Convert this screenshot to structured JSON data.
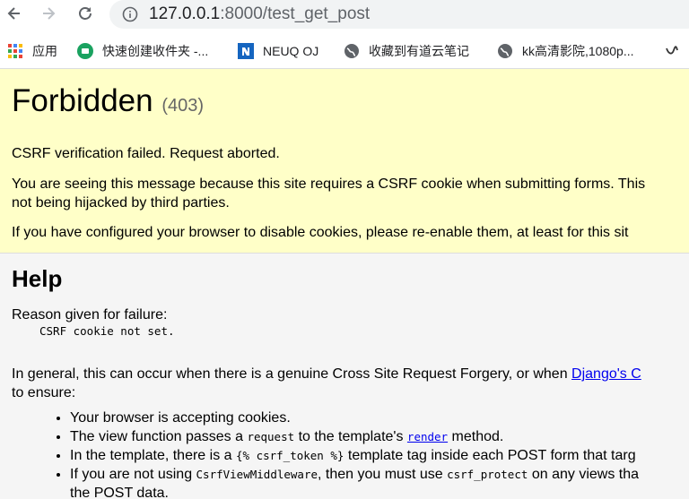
{
  "browser": {
    "url_host": "127.0.0.1",
    "url_rest": ":8000/test_get_post",
    "bookmarks": [
      {
        "label": "应用",
        "icon": "apps-grid-icon"
      },
      {
        "label": "快速创建收件夹 -...",
        "icon": "green-app-icon"
      },
      {
        "label": "NEUQ OJ",
        "icon": "blue-n-icon"
      },
      {
        "label": "收藏到有道云笔记",
        "icon": "globe-icon"
      },
      {
        "label": "kk高清影院,1080p...",
        "icon": "globe-icon"
      }
    ]
  },
  "summary": {
    "title": "Forbidden",
    "code": "(403)",
    "line1": "CSRF verification failed. Request aborted.",
    "line2a": "You are seeing this message because this site requires a CSRF cookie when submitting forms. This",
    "line2b": "not being hijacked by third parties.",
    "line3": "If you have configured your browser to disable cookies, please re-enable them, at least for this sit"
  },
  "help": {
    "heading": "Help",
    "reason_label": "Reason given for failure:",
    "reason": "CSRF cookie not set.",
    "general_a": "In general, this can occur when there is a genuine Cross Site Request Forgery, or when ",
    "general_link": "Django's C",
    "general_b": "to ensure:",
    "items": {
      "i1": "Your browser is accepting cookies.",
      "i2_a": "The view function passes a ",
      "i2_code": "request",
      "i2_b": " to the template's ",
      "i2_link": "render",
      "i2_c": " method.",
      "i3_a": "In the template, there is a ",
      "i3_code": "{% csrf_token %}",
      "i3_b": " template tag inside each POST form that targ",
      "i4_a": "If you are not using ",
      "i4_code": "CsrfViewMiddleware",
      "i4_b": ", then you must use ",
      "i4_code2": "csrf_protect",
      "i4_c": " on any views tha",
      "i4_d": "the POST data."
    }
  }
}
